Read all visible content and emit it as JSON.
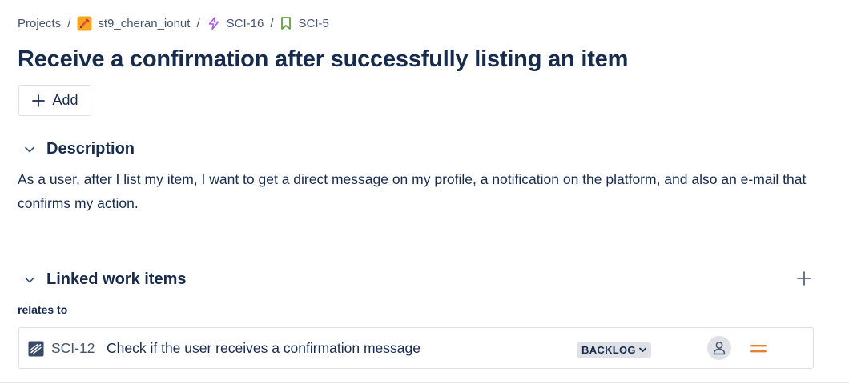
{
  "breadcrumb": {
    "projects": "Projects",
    "project": "st9_cheran_ionut",
    "epic": "SCI-16",
    "story": "SCI-5",
    "separator": "/"
  },
  "issue": {
    "title": "Receive a confirmation after successfully listing an item"
  },
  "toolbar": {
    "add_label": "Add"
  },
  "description": {
    "header": "Description",
    "text": "As a user, after I list my item, I want to get a direct message on my profile, a notification on the platform, and also an e-mail that confirms my action."
  },
  "linked": {
    "header": "Linked work items",
    "relation": "relates to",
    "items": [
      {
        "key": "SCI-12",
        "summary": "Check if the user receives a confirmation message",
        "status": "BACKLOG",
        "type_icon": "task-icon",
        "priority_icon": "priority-medium-icon",
        "assignee_icon": "unassigned-avatar-icon"
      }
    ]
  },
  "colors": {
    "text_primary": "#172b4d",
    "text_subtle": "#44546f",
    "epic_purple": "#9f5fe8",
    "story_green": "#63a03c",
    "project_orange": "#f5a623",
    "priority_orange": "#e97f33",
    "badge_bg": "#dfe1e6",
    "border": "#dcdfe4"
  }
}
